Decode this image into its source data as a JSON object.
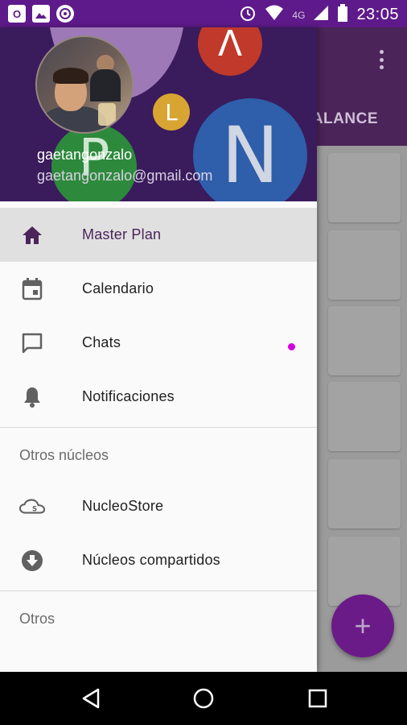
{
  "status_bar": {
    "notif_icons": [
      "office-icon",
      "image-icon",
      "globe-icon"
    ],
    "network": "4G",
    "time": "23:05"
  },
  "background_app": {
    "tab_label": "ALANCE",
    "fab_label": "+"
  },
  "drawer": {
    "header": {
      "username": "gaetangonzalo",
      "email": "gaetangonzalo@gmail.com",
      "letters": {
        "red": "Λ",
        "yellow": "L",
        "green": "P",
        "blue": "N"
      }
    },
    "items": [
      {
        "label": "Master Plan",
        "icon": "home-icon",
        "active": true
      },
      {
        "label": "Calendario",
        "icon": "calendar-icon",
        "active": false
      },
      {
        "label": "Chats",
        "icon": "chat-icon",
        "active": false
      },
      {
        "label": "Notificaciones",
        "icon": "bell-icon",
        "active": false
      }
    ],
    "section_other_nucleos": "Otros núcleos",
    "items_nucleos": [
      {
        "label": "NucleoStore",
        "icon": "cloud-store-icon"
      },
      {
        "label": "Núcleos compartidos",
        "icon": "download-circle-icon"
      }
    ],
    "section_otros": "Otros"
  },
  "colors": {
    "status_bar": "#5e1a8a",
    "accent": "#4b2459",
    "fab": "#6a1b88",
    "unread_dot": "#d400e0"
  }
}
